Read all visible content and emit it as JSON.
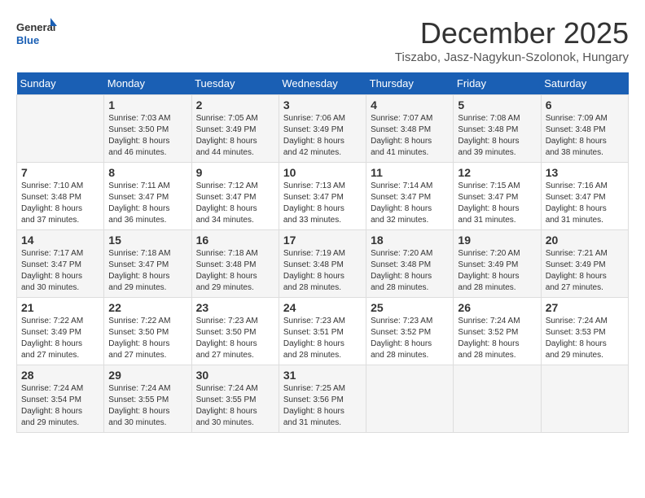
{
  "logo": {
    "line1": "General",
    "line2": "Blue"
  },
  "title": "December 2025",
  "subtitle": "Tiszabo, Jasz-Nagykun-Szolonok, Hungary",
  "days_of_week": [
    "Sunday",
    "Monday",
    "Tuesday",
    "Wednesday",
    "Thursday",
    "Friday",
    "Saturday"
  ],
  "weeks": [
    [
      {
        "day": "",
        "info": ""
      },
      {
        "day": "1",
        "info": "Sunrise: 7:03 AM\nSunset: 3:50 PM\nDaylight: 8 hours\nand 46 minutes."
      },
      {
        "day": "2",
        "info": "Sunrise: 7:05 AM\nSunset: 3:49 PM\nDaylight: 8 hours\nand 44 minutes."
      },
      {
        "day": "3",
        "info": "Sunrise: 7:06 AM\nSunset: 3:49 PM\nDaylight: 8 hours\nand 42 minutes."
      },
      {
        "day": "4",
        "info": "Sunrise: 7:07 AM\nSunset: 3:48 PM\nDaylight: 8 hours\nand 41 minutes."
      },
      {
        "day": "5",
        "info": "Sunrise: 7:08 AM\nSunset: 3:48 PM\nDaylight: 8 hours\nand 39 minutes."
      },
      {
        "day": "6",
        "info": "Sunrise: 7:09 AM\nSunset: 3:48 PM\nDaylight: 8 hours\nand 38 minutes."
      }
    ],
    [
      {
        "day": "7",
        "info": "Sunrise: 7:10 AM\nSunset: 3:48 PM\nDaylight: 8 hours\nand 37 minutes."
      },
      {
        "day": "8",
        "info": "Sunrise: 7:11 AM\nSunset: 3:47 PM\nDaylight: 8 hours\nand 36 minutes."
      },
      {
        "day": "9",
        "info": "Sunrise: 7:12 AM\nSunset: 3:47 PM\nDaylight: 8 hours\nand 34 minutes."
      },
      {
        "day": "10",
        "info": "Sunrise: 7:13 AM\nSunset: 3:47 PM\nDaylight: 8 hours\nand 33 minutes."
      },
      {
        "day": "11",
        "info": "Sunrise: 7:14 AM\nSunset: 3:47 PM\nDaylight: 8 hours\nand 32 minutes."
      },
      {
        "day": "12",
        "info": "Sunrise: 7:15 AM\nSunset: 3:47 PM\nDaylight: 8 hours\nand 31 minutes."
      },
      {
        "day": "13",
        "info": "Sunrise: 7:16 AM\nSunset: 3:47 PM\nDaylight: 8 hours\nand 31 minutes."
      }
    ],
    [
      {
        "day": "14",
        "info": "Sunrise: 7:17 AM\nSunset: 3:47 PM\nDaylight: 8 hours\nand 30 minutes."
      },
      {
        "day": "15",
        "info": "Sunrise: 7:18 AM\nSunset: 3:47 PM\nDaylight: 8 hours\nand 29 minutes."
      },
      {
        "day": "16",
        "info": "Sunrise: 7:18 AM\nSunset: 3:48 PM\nDaylight: 8 hours\nand 29 minutes."
      },
      {
        "day": "17",
        "info": "Sunrise: 7:19 AM\nSunset: 3:48 PM\nDaylight: 8 hours\nand 28 minutes."
      },
      {
        "day": "18",
        "info": "Sunrise: 7:20 AM\nSunset: 3:48 PM\nDaylight: 8 hours\nand 28 minutes."
      },
      {
        "day": "19",
        "info": "Sunrise: 7:20 AM\nSunset: 3:49 PM\nDaylight: 8 hours\nand 28 minutes."
      },
      {
        "day": "20",
        "info": "Sunrise: 7:21 AM\nSunset: 3:49 PM\nDaylight: 8 hours\nand 27 minutes."
      }
    ],
    [
      {
        "day": "21",
        "info": "Sunrise: 7:22 AM\nSunset: 3:49 PM\nDaylight: 8 hours\nand 27 minutes."
      },
      {
        "day": "22",
        "info": "Sunrise: 7:22 AM\nSunset: 3:50 PM\nDaylight: 8 hours\nand 27 minutes."
      },
      {
        "day": "23",
        "info": "Sunrise: 7:23 AM\nSunset: 3:50 PM\nDaylight: 8 hours\nand 27 minutes."
      },
      {
        "day": "24",
        "info": "Sunrise: 7:23 AM\nSunset: 3:51 PM\nDaylight: 8 hours\nand 28 minutes."
      },
      {
        "day": "25",
        "info": "Sunrise: 7:23 AM\nSunset: 3:52 PM\nDaylight: 8 hours\nand 28 minutes."
      },
      {
        "day": "26",
        "info": "Sunrise: 7:24 AM\nSunset: 3:52 PM\nDaylight: 8 hours\nand 28 minutes."
      },
      {
        "day": "27",
        "info": "Sunrise: 7:24 AM\nSunset: 3:53 PM\nDaylight: 8 hours\nand 29 minutes."
      }
    ],
    [
      {
        "day": "28",
        "info": "Sunrise: 7:24 AM\nSunset: 3:54 PM\nDaylight: 8 hours\nand 29 minutes."
      },
      {
        "day": "29",
        "info": "Sunrise: 7:24 AM\nSunset: 3:55 PM\nDaylight: 8 hours\nand 30 minutes."
      },
      {
        "day": "30",
        "info": "Sunrise: 7:24 AM\nSunset: 3:55 PM\nDaylight: 8 hours\nand 30 minutes."
      },
      {
        "day": "31",
        "info": "Sunrise: 7:25 AM\nSunset: 3:56 PM\nDaylight: 8 hours\nand 31 minutes."
      },
      {
        "day": "",
        "info": ""
      },
      {
        "day": "",
        "info": ""
      },
      {
        "day": "",
        "info": ""
      }
    ]
  ]
}
